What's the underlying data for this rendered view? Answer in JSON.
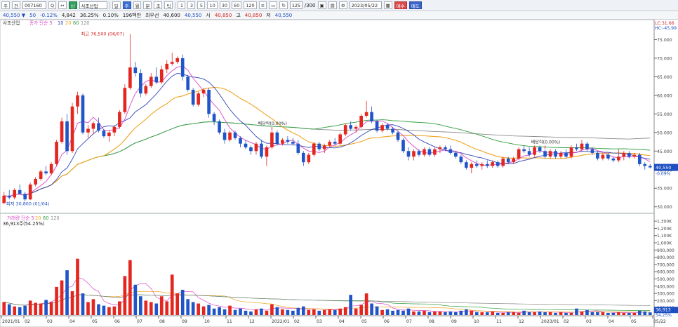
{
  "toolbar": {
    "market_prefix": "주",
    "market_type": "건",
    "code": "007160",
    "search_q": "Q",
    "pin": "↔",
    "new_badge": "신",
    "company": "사조산업",
    "periods": [
      "일",
      "주",
      "월",
      "분",
      "초",
      "틱"
    ],
    "active_period": "주",
    "intervals": [
      "1",
      "3",
      "5",
      "10",
      "30",
      "60",
      "120"
    ],
    "count": "125",
    "max_count": "300",
    "date": "2023/05/22",
    "buy": "매수",
    "sell": "매도"
  },
  "quote": {
    "price": "40,550",
    "arrow": "▼",
    "change": "50",
    "change_pct": "-0.12%",
    "volume": "4,842",
    "turnover_pct": "36.25%",
    "vol_ratio_pct": "0.10%",
    "amount": "196백만",
    "open_label": "최우선",
    "open": "40,600",
    "ask": "40,550",
    "high_label": "시",
    "high": "40,850",
    "low_label": "고",
    "low": "40,850",
    "close_label": "저",
    "close": "40,550"
  },
  "chart_data": {
    "type": "candlestick",
    "title": "사조산업",
    "legend": {
      "price": [
        "종가 단순 5",
        "10",
        "20",
        "60",
        "120"
      ],
      "volume": [
        "거래량 단순 5",
        "20",
        "60",
        "120"
      ]
    },
    "colors": {
      "up": "#e3261f",
      "down": "#1f55c9",
      "ma5": "#d946c9",
      "ma10": "#3346b8",
      "ma20": "#f0a420",
      "ma60": "#2e9e3c",
      "ma120": "#8a8a8a"
    },
    "x_labels": [
      "2021/01",
      "02",
      "03",
      "04",
      "05",
      "06",
      "07",
      "08",
      "09",
      "10",
      "11",
      "12",
      "2022/01",
      "02",
      "03",
      "04",
      "05",
      "06",
      "07",
      "08",
      "09",
      "10",
      "11",
      "12",
      "2023/01",
      "02",
      "03",
      "04",
      "05",
      "05/22"
    ],
    "y_price_ticks": [
      "75.000",
      "70.000",
      "65.000",
      "60.000",
      "55.000",
      "50.000",
      "45.000",
      "40.000",
      "35.000",
      "30.000"
    ],
    "y_price_range": [
      29000,
      80000
    ],
    "y_volume_ticks": [
      "1,300K",
      "1,200K",
      "1,100K",
      "1,000K",
      "900,000",
      "800,000",
      "700,000",
      "600,000",
      "500,000",
      "400,000",
      "300,000",
      "200,000",
      "100,000"
    ],
    "y_volume_range": [
      0,
      1350000
    ],
    "price_axis_top": "LC:31.66",
    "price_axis_top2": "HC:-45.99",
    "current_price_label": "40,550",
    "current_price_pct": "-0.09%",
    "current_volume_label": "36,913",
    "current_volume_pct": "54.25%",
    "volume_readout": "36,913주(54.25%)",
    "annotations": [
      {
        "text": "최고 76,500 (06/07)",
        "week": 24
      },
      {
        "text": "최저 30,800 (01/04)",
        "week": 0
      },
      {
        "text": "배당락(0.00%)",
        "week": 51
      },
      {
        "text": "배당락(0.00%)",
        "week": 103
      }
    ],
    "candles": [
      [
        31000,
        34000,
        30800,
        33000
      ],
      [
        33000,
        34500,
        32000,
        32500
      ],
      [
        32500,
        35000,
        32000,
        34500
      ],
      [
        34500,
        36000,
        33500,
        33500
      ],
      [
        33500,
        34000,
        31500,
        32000
      ],
      [
        32000,
        36500,
        31800,
        36000
      ],
      [
        36000,
        38000,
        35500,
        37500
      ],
      [
        37500,
        40000,
        37000,
        39500
      ],
      [
        39500,
        41000,
        38500,
        39000
      ],
      [
        39000,
        42000,
        38500,
        41500
      ],
      [
        41500,
        48000,
        41000,
        47500
      ],
      [
        47500,
        54000,
        47000,
        53000
      ],
      [
        53000,
        55000,
        44000,
        45000
      ],
      [
        45000,
        58000,
        44500,
        57000
      ],
      [
        57000,
        61000,
        55000,
        60000
      ],
      [
        60000,
        60500,
        49500,
        50000
      ],
      [
        50000,
        52000,
        48500,
        51000
      ],
      [
        51000,
        53000,
        49500,
        52500
      ],
      [
        52500,
        54000,
        50000,
        50500
      ],
      [
        50500,
        51000,
        48500,
        49000
      ],
      [
        49000,
        50500,
        47500,
        50000
      ],
      [
        50000,
        52000,
        49000,
        51500
      ],
      [
        51500,
        56000,
        51000,
        55500
      ],
      [
        55500,
        63000,
        55000,
        62000
      ],
      [
        62000,
        76500,
        61500,
        67500
      ],
      [
        67500,
        69000,
        65000,
        66000
      ],
      [
        66000,
        67000,
        59500,
        60500
      ],
      [
        60500,
        63000,
        60000,
        62500
      ],
      [
        62500,
        66000,
        62000,
        65000
      ],
      [
        65000,
        67500,
        63000,
        63500
      ],
      [
        63500,
        68000,
        63000,
        67000
      ],
      [
        67000,
        69500,
        66000,
        68500
      ],
      [
        68500,
        71500,
        68000,
        69000
      ],
      [
        69000,
        70500,
        68500,
        70000
      ],
      [
        70000,
        71000,
        64000,
        65000
      ],
      [
        65000,
        65500,
        61000,
        61500
      ],
      [
        61500,
        62000,
        57000,
        57500
      ],
      [
        57500,
        61000,
        57000,
        60500
      ],
      [
        60500,
        62000,
        59500,
        61500
      ],
      [
        61500,
        62000,
        54000,
        55000
      ],
      [
        55000,
        55500,
        52000,
        53000
      ],
      [
        53000,
        53500,
        49500,
        50000
      ],
      [
        50000,
        51000,
        47000,
        48000
      ],
      [
        48000,
        50500,
        47500,
        50000
      ],
      [
        50000,
        50500,
        48000,
        48500
      ],
      [
        48500,
        49000,
        46000,
        47000
      ],
      [
        47000,
        48000,
        45500,
        46000
      ],
      [
        46000,
        46500,
        44000,
        45000
      ],
      [
        45000,
        47500,
        44000,
        47000
      ],
      [
        47000,
        48000,
        43000,
        43500
      ],
      [
        43500,
        46500,
        41000,
        46000
      ],
      [
        46000,
        50500,
        45500,
        50000
      ],
      [
        50000,
        50500,
        46500,
        47000
      ],
      [
        47000,
        48500,
        46500,
        48000
      ],
      [
        48000,
        49000,
        47000,
        47500
      ],
      [
        47500,
        48500,
        46500,
        47000
      ],
      [
        47000,
        48000,
        44000,
        44500
      ],
      [
        44500,
        45000,
        41000,
        42000
      ],
      [
        42000,
        44500,
        41500,
        44000
      ],
      [
        44000,
        47500,
        43500,
        47000
      ],
      [
        47000,
        47500,
        45000,
        45500
      ],
      [
        45500,
        47000,
        44500,
        46500
      ],
      [
        46500,
        48000,
        46000,
        47500
      ],
      [
        47500,
        48500,
        46500,
        47000
      ],
      [
        47000,
        50000,
        46500,
        49500
      ],
      [
        49500,
        52500,
        49000,
        52000
      ],
      [
        52000,
        53000,
        50500,
        51000
      ],
      [
        51000,
        52000,
        50000,
        51500
      ],
      [
        51500,
        55000,
        51000,
        54500
      ],
      [
        54500,
        58500,
        54000,
        55500
      ],
      [
        55500,
        57000,
        52500,
        53000
      ],
      [
        53000,
        53500,
        50000,
        50500
      ],
      [
        50500,
        52500,
        50000,
        52000
      ],
      [
        52000,
        52500,
        50500,
        51000
      ],
      [
        51000,
        51500,
        49500,
        50000
      ],
      [
        50000,
        50500,
        47500,
        48000
      ],
      [
        48000,
        48500,
        44500,
        45000
      ],
      [
        45000,
        46000,
        42500,
        43500
      ],
      [
        43500,
        45500,
        42500,
        45000
      ],
      [
        45000,
        45500,
        43500,
        44000
      ],
      [
        44000,
        46000,
        43500,
        45500
      ],
      [
        45500,
        46000,
        43500,
        44000
      ],
      [
        44000,
        46000,
        43500,
        45500
      ],
      [
        45500,
        46500,
        44500,
        46000
      ],
      [
        46000,
        46500,
        45000,
        45500
      ],
      [
        45500,
        46500,
        44000,
        44500
      ],
      [
        44500,
        45000,
        43000,
        43500
      ],
      [
        43500,
        44000,
        41500,
        42000
      ],
      [
        42000,
        42500,
        40000,
        40500
      ],
      [
        40500,
        42000,
        39000,
        41500
      ],
      [
        41500,
        42500,
        40500,
        41000
      ],
      [
        41000,
        42000,
        40000,
        41500
      ],
      [
        41500,
        42500,
        40500,
        41000
      ],
      [
        41000,
        42500,
        40500,
        42000
      ],
      [
        42000,
        42500,
        40500,
        41000
      ],
      [
        41000,
        43500,
        40500,
        43000
      ],
      [
        43000,
        43500,
        41500,
        42000
      ],
      [
        42000,
        43500,
        41500,
        43000
      ],
      [
        43000,
        46000,
        42500,
        45500
      ],
      [
        45500,
        46500,
        44500,
        45000
      ],
      [
        45000,
        46000,
        43500,
        44000
      ],
      [
        44000,
        46500,
        43500,
        46000
      ],
      [
        46000,
        46500,
        44500,
        45000
      ],
      [
        45000,
        45500,
        43000,
        43500
      ],
      [
        43500,
        45500,
        43000,
        45000
      ],
      [
        45000,
        45500,
        43000,
        43500
      ],
      [
        43500,
        45000,
        43000,
        44500
      ],
      [
        44500,
        45500,
        43000,
        43500
      ],
      [
        43500,
        46500,
        43000,
        46000
      ],
      [
        46000,
        47000,
        45000,
        45500
      ],
      [
        45500,
        48000,
        45000,
        47000
      ],
      [
        47000,
        47500,
        45000,
        45500
      ],
      [
        45500,
        46000,
        44000,
        44500
      ],
      [
        44500,
        45000,
        42500,
        43000
      ],
      [
        43000,
        44500,
        42500,
        44000
      ],
      [
        44000,
        44500,
        42500,
        43000
      ],
      [
        43000,
        43500,
        42000,
        42500
      ],
      [
        42500,
        45500,
        42000,
        43500
      ],
      [
        43500,
        45000,
        42500,
        44500
      ],
      [
        44500,
        45000,
        43000,
        43500
      ],
      [
        43500,
        44500,
        43000,
        44000
      ],
      [
        44000,
        44500,
        41000,
        41500
      ],
      [
        41500,
        42000,
        40000,
        41000
      ],
      [
        41000,
        41500,
        40300,
        40600
      ]
    ],
    "volumes": [
      180000,
      150000,
      120000,
      110000,
      130000,
      200000,
      170000,
      160000,
      210000,
      180000,
      390000,
      480000,
      620000,
      330000,
      780000,
      300000,
      180000,
      220000,
      150000,
      130000,
      110000,
      120000,
      190000,
      540000,
      760000,
      420000,
      260000,
      200000,
      180000,
      160000,
      260000,
      190000,
      560000,
      300000,
      350000,
      220000,
      180000,
      160000,
      120000,
      140000,
      90000,
      110000,
      80000,
      130000,
      70000,
      90000,
      60000,
      50000,
      80000,
      90000,
      60000,
      150000,
      110000,
      80000,
      70000,
      60000,
      100000,
      120000,
      70000,
      80000,
      60000,
      70000,
      80000,
      70000,
      90000,
      110000,
      280000,
      90000,
      140000,
      300000,
      160000,
      120000,
      70000,
      80000,
      60000,
      70000,
      60000,
      90000,
      50000,
      50000,
      60000,
      40000,
      50000,
      50000,
      40000,
      50000,
      40000,
      60000,
      80000,
      60000,
      40000,
      40000,
      40000,
      50000,
      30000,
      30000,
      40000,
      40000,
      30000,
      60000,
      40000,
      40000,
      50000,
      40000,
      40000,
      30000,
      40000,
      30000,
      30000,
      90000,
      50000,
      70000,
      40000,
      40000,
      40000,
      30000,
      30000,
      40000,
      30000,
      30000,
      30000,
      60000,
      50000,
      36913
    ]
  }
}
